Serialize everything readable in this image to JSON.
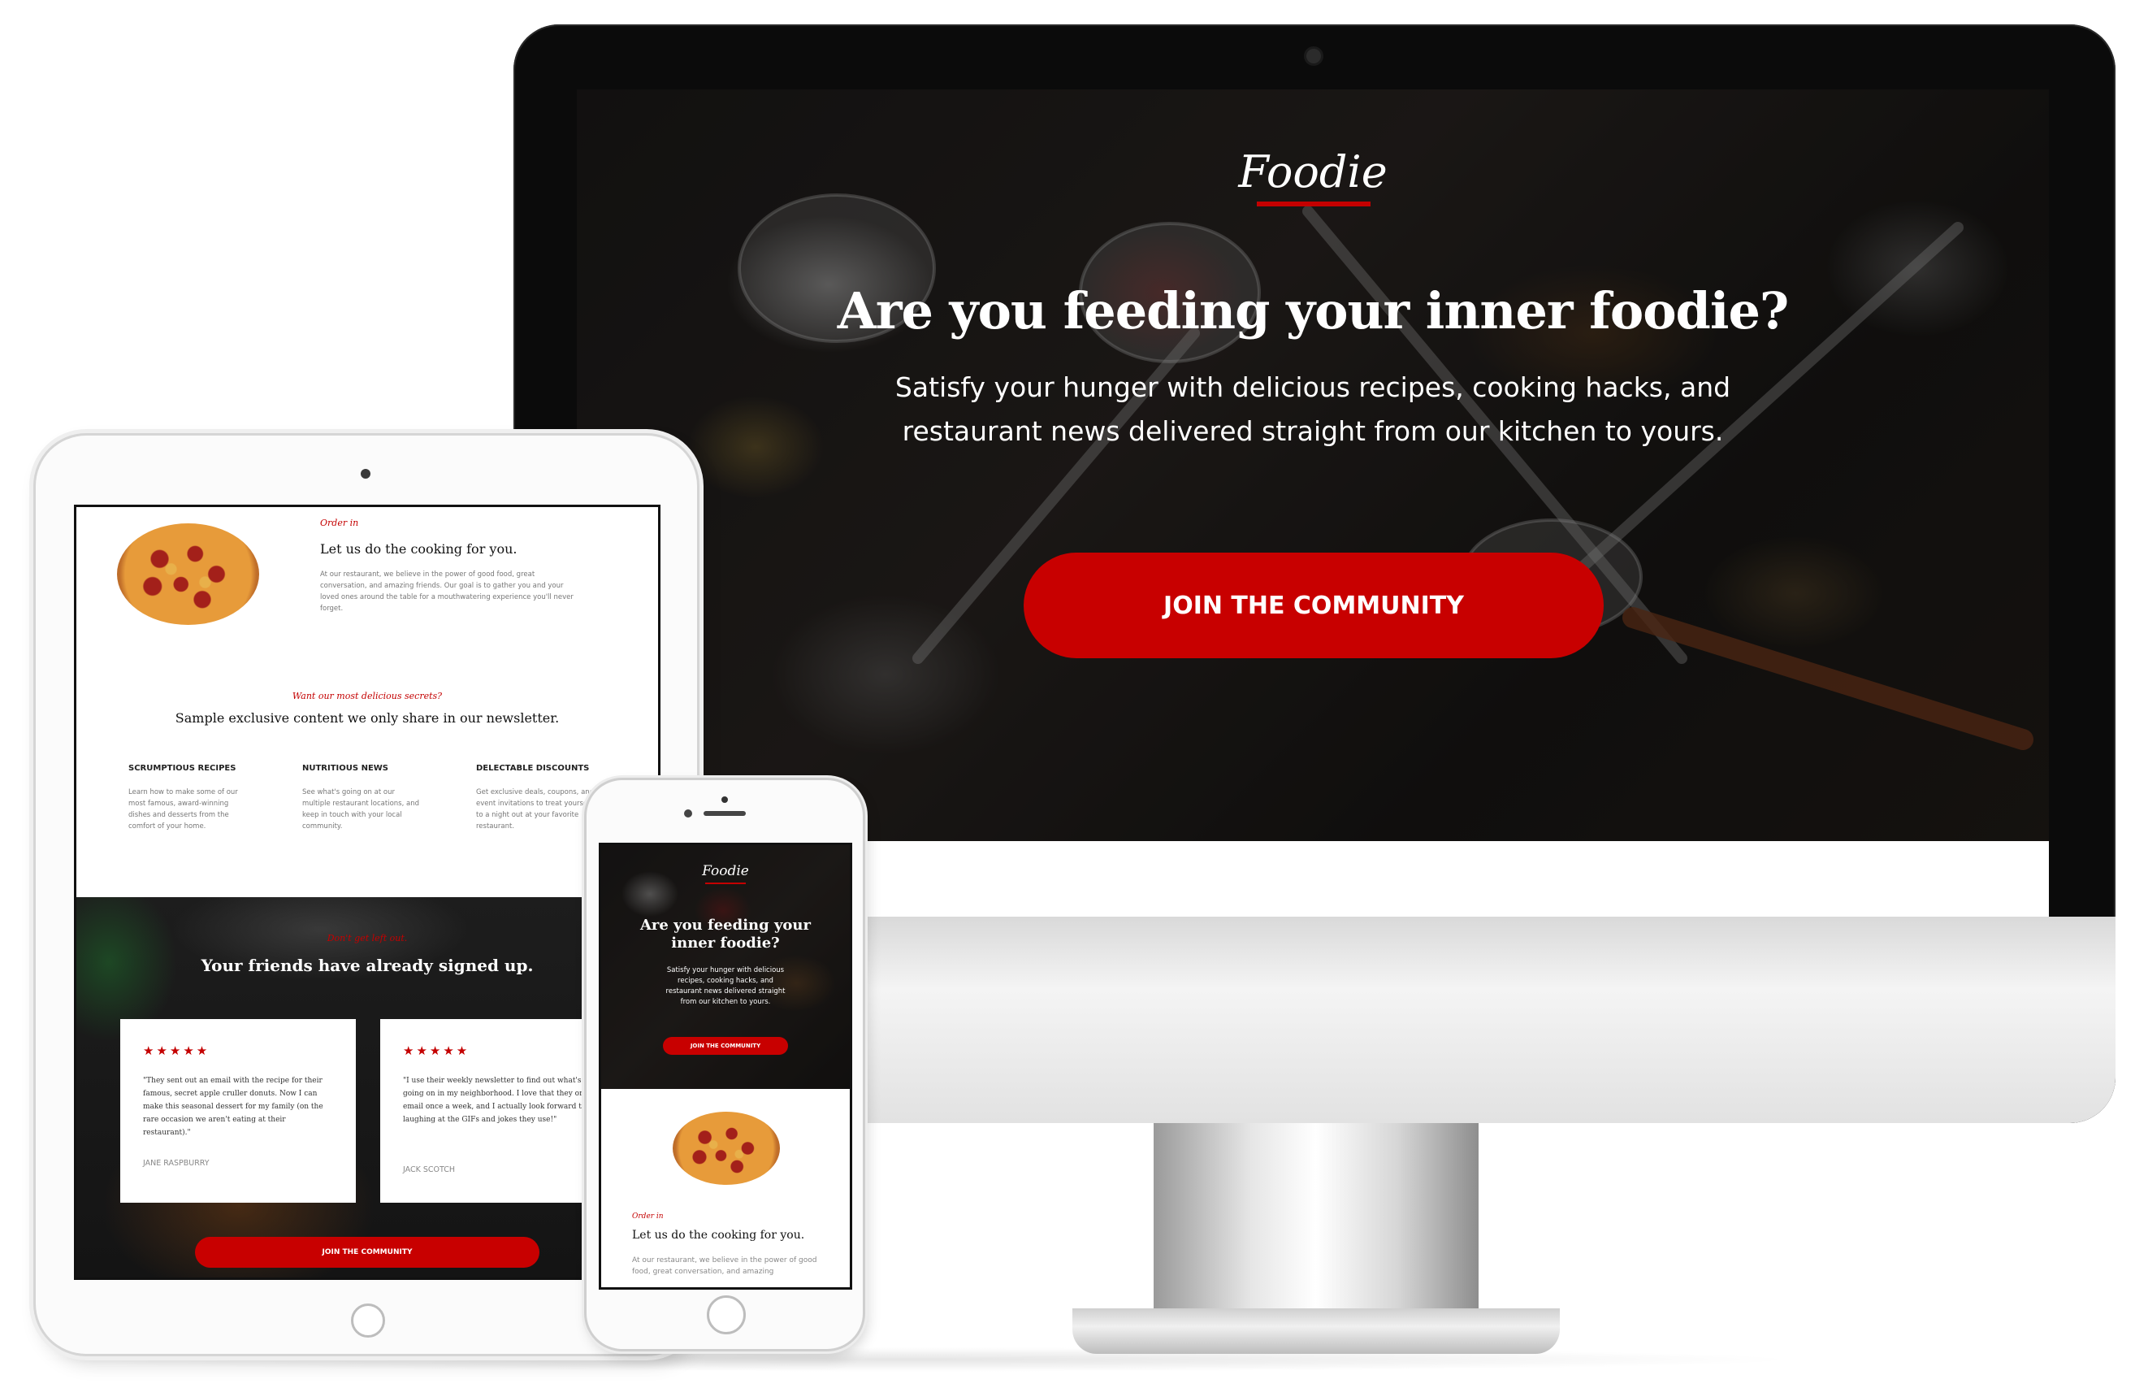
{
  "desktop": {
    "logo": "Foodie",
    "headline": "Are you feeding your inner foodie?",
    "subheadline": "Satisfy your hunger with delicious recipes, cooking hacks, and restaurant news delivered straight from our kitchen to yours.",
    "cta_label": "JOIN THE COMMUNITY"
  },
  "tablet": {
    "order_eyebrow": "Order in",
    "order_title": "Let us do the cooking for you.",
    "order_body": "At our restaurant, we believe in the power of good food, great conversation, and amazing friends. Our goal is to gather you and your loved ones around the table for a mouthwatering experience you'll never forget.",
    "secrets_eyebrow": "Want our most delicious secrets?",
    "secrets_title": "Sample exclusive content we only share in our newsletter.",
    "columns": [
      {
        "heading": "SCRUMPTIOUS RECIPES",
        "body": "Learn how to make some of our most famous, award-winning dishes and desserts from the comfort of your home."
      },
      {
        "heading": "NUTRITIOUS NEWS",
        "body": "See what's going on at our multiple restaurant locations, and keep in touch with your local community."
      },
      {
        "heading": "DELECTABLE DISCOUNTS",
        "body": "Get exclusive deals, coupons, and event invitations to treat yourself to a night out at your favorite restaurant."
      }
    ],
    "social_eyebrow": "Don't get left out.",
    "social_title": "Your friends have already signed up.",
    "reviews": [
      {
        "stars": "★★★★★",
        "quote": "\"They sent out an email with the recipe for their famous, secret apple cruller donuts. Now I can make this seasonal dessert for my family (on the rare occasion we aren't eating at their restaurant).\"",
        "name": "JANE RASPBURRY"
      },
      {
        "stars": "★★★★★",
        "quote": "\"I use their weekly newsletter to find out what's going on in my neighborhood. I love that they only email once a week, and I actually look forward to laughing at the GIFs and jokes they use!\"",
        "name": "JACK SCOTCH"
      }
    ],
    "cta_label": "JOIN THE COMMUNITY"
  },
  "phone": {
    "logo": "Foodie",
    "headline": "Are you feeding your inner foodie?",
    "subheadline": "Satisfy your hunger with delicious recipes, cooking hacks, and restaurant news delivered straight from our kitchen to yours.",
    "cta_label": "JOIN THE COMMUNITY",
    "order_eyebrow": "Order in",
    "order_title": "Let us do the cooking for you.",
    "order_body": "At our restaurant, we believe in the power of good food, great conversation, and amazing"
  },
  "colors": {
    "brand_red": "#c80000",
    "hero_dark": "#1d1b1a"
  },
  "icons": [
    "star-icon",
    "pizza-image"
  ]
}
